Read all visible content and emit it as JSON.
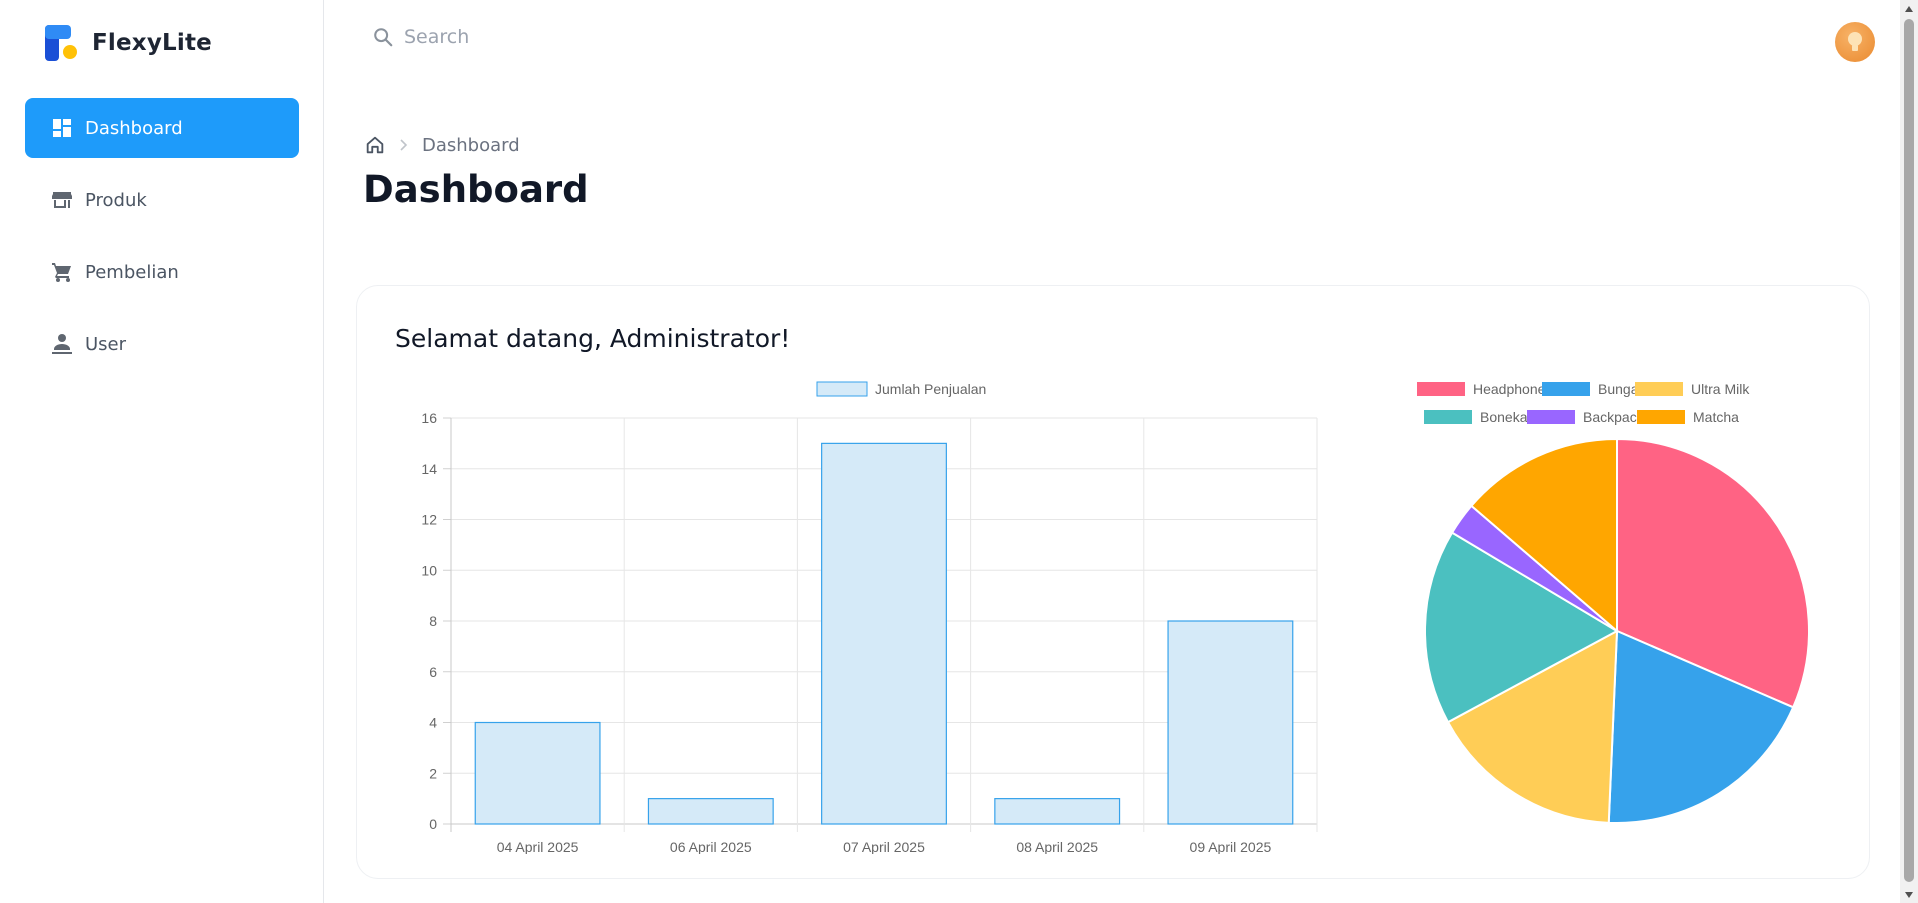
{
  "brand": {
    "name": "FlexyLite"
  },
  "sidebar": {
    "items": [
      {
        "label": "Dashboard",
        "icon": "dashboard-icon",
        "active": true
      },
      {
        "label": "Produk",
        "icon": "store-icon",
        "active": false
      },
      {
        "label": "Pembelian",
        "icon": "cart-icon",
        "active": false
      },
      {
        "label": "User",
        "icon": "user-icon",
        "active": false
      }
    ]
  },
  "header": {
    "search_placeholder": "Search"
  },
  "breadcrumb": {
    "current": "Dashboard"
  },
  "page": {
    "title": "Dashboard"
  },
  "card": {
    "welcome": "Selamat datang, Administrator!"
  },
  "colors": {
    "accent": "#1e9bfa",
    "bar_fill": "#d5eaf8",
    "bar_stroke": "#36a2eb"
  },
  "chart_data": [
    {
      "type": "bar",
      "categories": [
        "04 April 2025",
        "06 April 2025",
        "07 April 2025",
        "08 April 2025",
        "09 April 2025"
      ],
      "series": [
        {
          "name": "Jumlah Penjualan",
          "values": [
            4,
            1,
            15,
            1,
            8
          ]
        }
      ],
      "ylim": [
        0,
        16
      ],
      "yticks": [
        0,
        2,
        4,
        6,
        8,
        10,
        12,
        14,
        16
      ],
      "grid": true,
      "legend": "top"
    },
    {
      "type": "pie",
      "labels": [
        "Headphone",
        "Bunga",
        "Ultra Milk",
        "Boneka",
        "Backpack",
        "Matcha"
      ],
      "values": [
        11.5,
        7,
        6,
        6,
        1,
        5
      ],
      "colors": [
        "#ff6384",
        "#36a2eb",
        "#ffcd56",
        "#4bc0c0",
        "#9966ff",
        "#ffa600"
      ],
      "legend": "top"
    }
  ]
}
